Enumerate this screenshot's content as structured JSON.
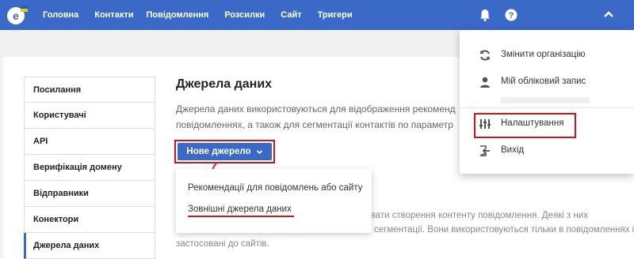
{
  "nav": {
    "items": [
      "Головна",
      "Контакти",
      "Повідомлення",
      "Розсилки",
      "Сайт",
      "Тригери"
    ]
  },
  "icons": {
    "logo": "esputnik-logo",
    "bell": "bell-icon",
    "help": "question-circle-icon",
    "collapse": "chevron-up-icon"
  },
  "sidebar": {
    "items": [
      {
        "label": "Посилання",
        "active": false
      },
      {
        "label": "Користувачі",
        "active": false
      },
      {
        "label": "API",
        "active": false
      },
      {
        "label": "Верифікація домену",
        "active": false
      },
      {
        "label": "Відправники",
        "active": false
      },
      {
        "label": "Конектори",
        "active": false
      },
      {
        "label": "Джерела даних",
        "active": true
      }
    ]
  },
  "main": {
    "title": "Джерела даних",
    "description_line1": "Джерела даних використовуються для відображення рекоменд",
    "description_line2": "повідомленнях, а також для сегментації контактів по параметр",
    "description_lower_line1": "ювати створення контенту повідомлення. Деякі з них",
    "description_lower_line2": "сегментації. Вони використовуються тільки в повідомленнях і не",
    "description_lower_line3": "застосовані до сайтів.",
    "new_source_button": "Нове джерело"
  },
  "dropdown": {
    "items": [
      "Рекомендації для повідомлень або сайту",
      "Зовнішні джерела даних"
    ]
  },
  "account_menu": {
    "switch_org": "Змінити організацію",
    "my_account": "Мій обліковий запис",
    "settings": "Налаштування",
    "logout": "Вихід"
  },
  "colors": {
    "primary": "#3b69c8",
    "highlight": "#d0141b",
    "logo_flag_blue": "#1a5fd0",
    "logo_flag_yellow": "#f5c400"
  }
}
